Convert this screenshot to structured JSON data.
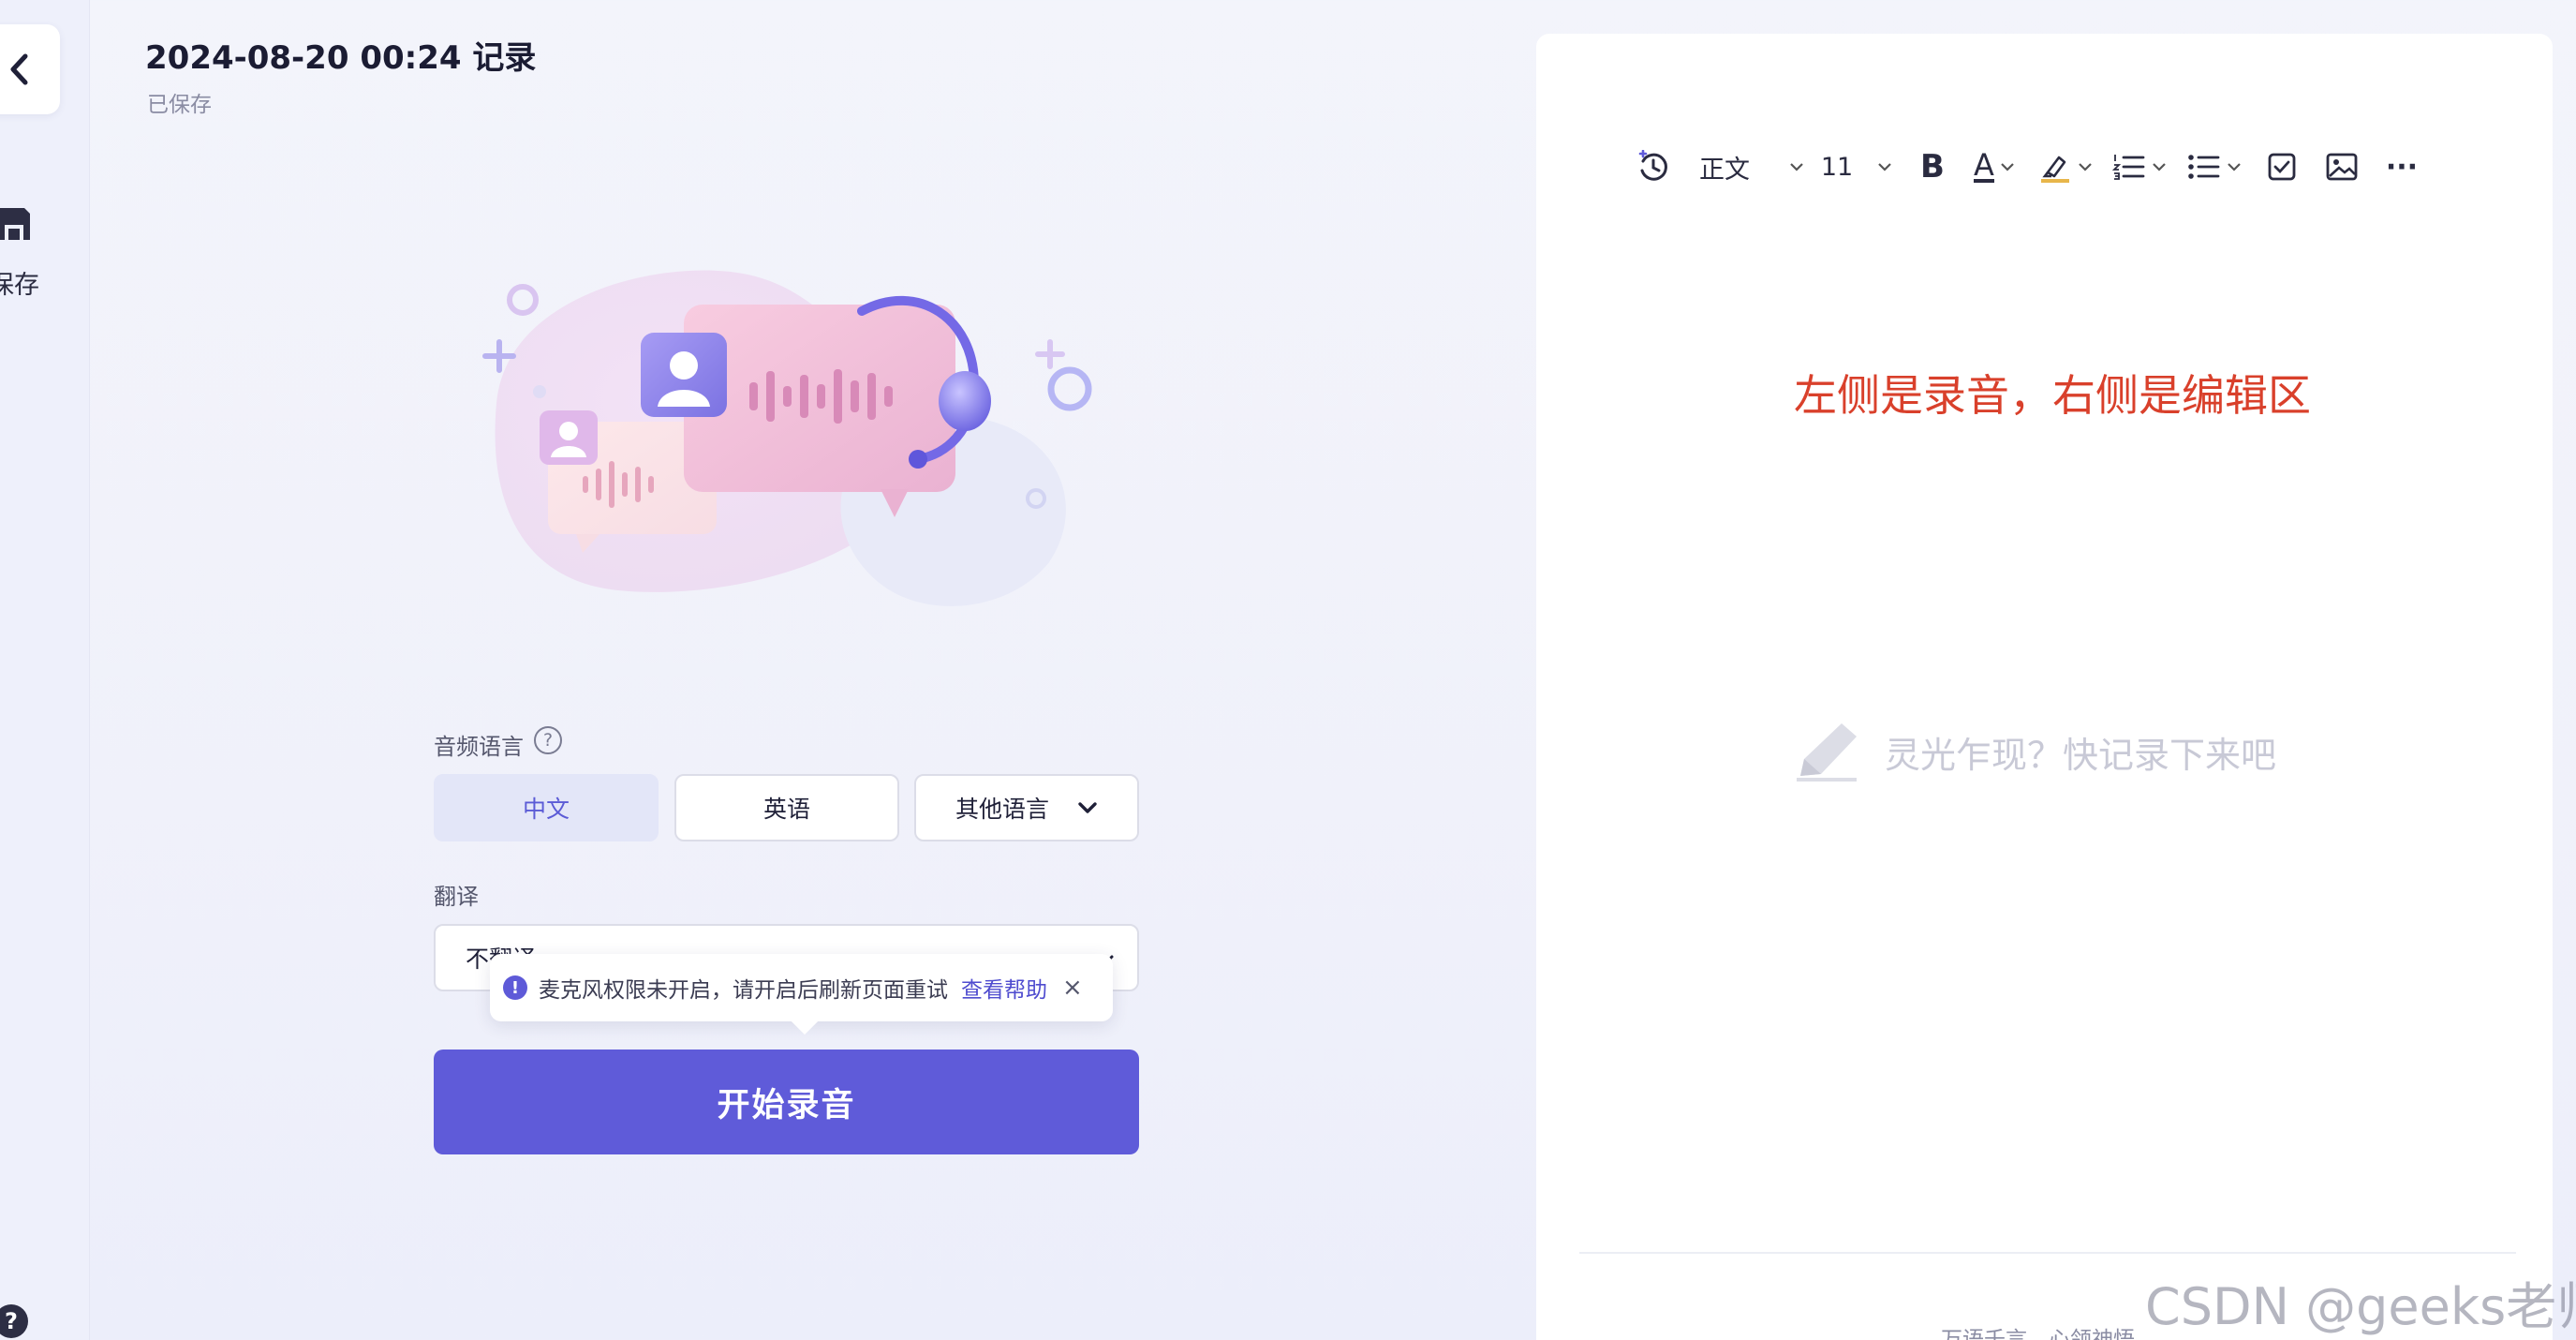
{
  "header": {
    "title": "2024-08-20 00:24 记录",
    "status": "已保存"
  },
  "sidebar": {
    "save_label": "保存",
    "back_icon": "chevron-left-icon",
    "save_icon": "floppy-icon",
    "help_icon": "question-icon"
  },
  "form": {
    "audio_language_label": "音频语言",
    "languages": [
      {
        "label": "中文",
        "active": true
      },
      {
        "label": "英语",
        "active": false
      },
      {
        "label": "其他语言",
        "active": false
      }
    ],
    "translation_label": "翻译",
    "translation_value": "不翻译",
    "start_button": "开始录音"
  },
  "toast": {
    "message": "麦克风权限未开启，请开启后刷新页面重试",
    "help_link": "查看帮助",
    "close": "×"
  },
  "editor": {
    "toolbar": {
      "paragraph_style": "正文",
      "font_size": "11",
      "bold": "B",
      "font_color": "A",
      "more": "···"
    },
    "annotation": "左侧是录音，右侧是编辑区",
    "placeholder": "灵光乍现？快记录下来吧",
    "slogan": "万语千言，心领神悟"
  },
  "watermark": "CSDN @geeks老师",
  "colors": {
    "accent": "#5f5bd9",
    "annotation_red": "#d9402b",
    "active_segment_bg": "#e3e6f8"
  }
}
